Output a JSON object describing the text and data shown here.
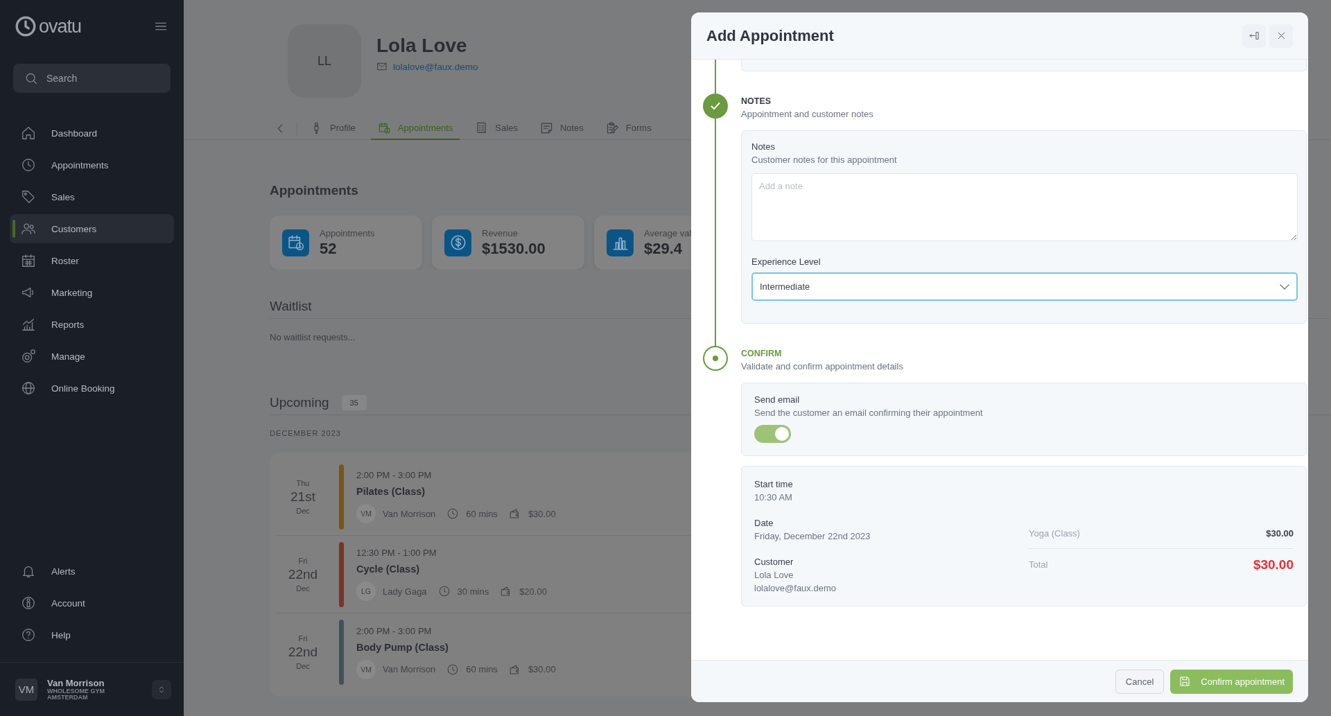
{
  "sidebar": {
    "logo": "ovatu",
    "search": {
      "placeholder": "Search"
    },
    "nav_items": [
      {
        "label": "Dashboard",
        "selected": false
      },
      {
        "label": "Appointments",
        "selected": false
      },
      {
        "label": "Sales",
        "selected": false
      },
      {
        "label": "Customers",
        "selected": true
      },
      {
        "label": "Roster",
        "selected": false
      },
      {
        "label": "Marketing",
        "selected": false
      },
      {
        "label": "Reports",
        "selected": false
      },
      {
        "label": "Manage",
        "selected": false
      },
      {
        "label": "Online Booking",
        "selected": false
      }
    ],
    "footer_items": [
      {
        "label": "Alerts"
      },
      {
        "label": "Account"
      },
      {
        "label": "Help"
      }
    ],
    "user": {
      "initials": "VM",
      "name": "Van Morrison",
      "org": "WHOLESOME GYM AMSTERDAM"
    }
  },
  "customer": {
    "initials": "LL",
    "name": "Lola Love",
    "email": "lolalove@faux.demo"
  },
  "tabs": [
    {
      "label": "Profile",
      "selected": false
    },
    {
      "label": "Appointments",
      "selected": true
    },
    {
      "label": "Sales",
      "selected": false
    },
    {
      "label": "Notes",
      "selected": false
    },
    {
      "label": "Forms",
      "selected": false
    }
  ],
  "appointments": {
    "title": "Appointments",
    "stats": [
      {
        "label": "Appointments",
        "value": "52"
      },
      {
        "label": "Revenue",
        "value": "$1530.00"
      },
      {
        "label": "Average val",
        "value": "$29.4"
      }
    ]
  },
  "waitlist": {
    "title": "Waitlist",
    "empty_text": "No waitlist requests..."
  },
  "upcoming": {
    "title": "Upcoming",
    "count": "35",
    "month": "DECEMBER 2023",
    "items": [
      {
        "weekday": "Thu",
        "day": "21st",
        "month": "Dec",
        "time": "2:00 PM - 3:00 PM",
        "name": "Pilates (Class)",
        "color": "#7a5418",
        "staff_initials": "VM",
        "staff": "Van Morrison",
        "duration": "60 mins",
        "price": "$30.00"
      },
      {
        "weekday": "Fri",
        "day": "22nd",
        "month": "Dec",
        "time": "12:30 PM - 1:00 PM",
        "name": "Cycle (Class)",
        "color": "#7a3426",
        "staff_initials": "LG",
        "staff": "Lady Gaga",
        "duration": "30 mins",
        "price": "$20.00"
      },
      {
        "weekday": "Fri",
        "day": "22nd",
        "month": "Dec",
        "time": "2:00 PM - 3:00 PM",
        "name": "Body Pump (Class)",
        "color": "#44505e",
        "staff_initials": "VM",
        "staff": "Van Morrison",
        "duration": "60 mins",
        "price": "$30.00"
      }
    ]
  },
  "modal": {
    "title": "Add Appointment",
    "notes_step": {
      "kind": "done",
      "title": "NOTES",
      "subtitle": "Appointment and customer notes",
      "notes": {
        "label": "Notes",
        "hint": "Customer notes for this appointment",
        "placeholder": "Add a note"
      },
      "experience": {
        "label": "Experience Level",
        "value": "Intermediate",
        "focused": true
      }
    },
    "confirm_step": {
      "kind": "current",
      "title": "CONFIRM",
      "subtitle": "Validate and confirm appointment details",
      "send_email": {
        "label": "Send email",
        "description": "Send the customer an email confirming their appointment",
        "on": true
      },
      "details": [
        {
          "label": "Start time",
          "lines": [
            "10:30 AM"
          ]
        },
        {
          "label": "Date",
          "lines": [
            "Friday, December 22nd 2023"
          ]
        },
        {
          "label": "Customer",
          "lines": [
            "Lola Love",
            "lolalove@faux.demo"
          ]
        }
      ],
      "line_items": [
        {
          "name": "Yoga (Class)",
          "price": "$30.00"
        }
      ],
      "total": {
        "label": "Total",
        "amount": "$30.00"
      }
    },
    "buttons": {
      "cancel": "Cancel",
      "confirm": "Confirm appointment"
    }
  }
}
